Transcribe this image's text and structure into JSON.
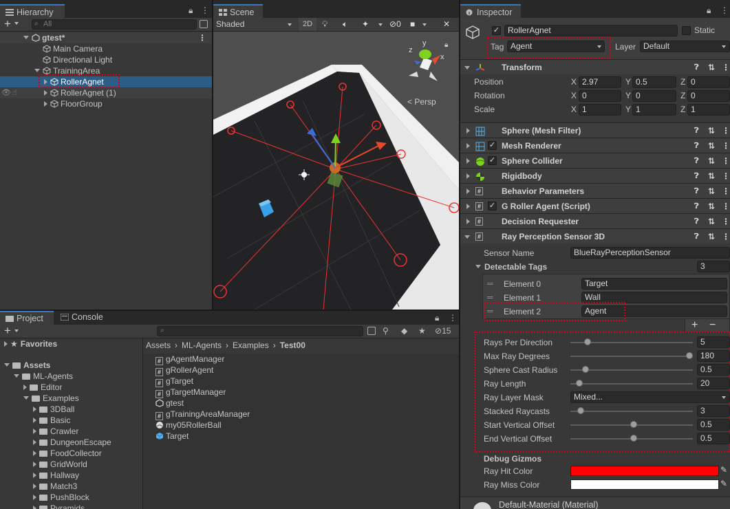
{
  "colors": {
    "selection": "#2c5d87",
    "accent": "#3a79bb",
    "highlight_box": "#d0021b",
    "ray_hit": "#ff0000",
    "ray_miss": "#ffffff"
  },
  "hierarchy": {
    "tab": "Hierarchy",
    "search_placeholder": "All",
    "scene": "gtest*",
    "items": [
      {
        "label": "Main Camera",
        "icon": "gameobject-icon"
      },
      {
        "label": "Directional Light",
        "icon": "gameobject-icon"
      },
      {
        "label": "TrainingArea",
        "icon": "gameobject-icon"
      },
      {
        "label": "RollerAgnet",
        "icon": "prefab-icon"
      },
      {
        "label": "RollerAgnet (1)",
        "icon": "prefab-icon"
      },
      {
        "label": "FloorGroup",
        "icon": "prefab-icon"
      }
    ]
  },
  "scene": {
    "tab": "Scene",
    "shading": "Shaded",
    "mode2d": "2D",
    "hidden_count": "0",
    "persp": "< Persp",
    "gizmo_axes": {
      "y": "y",
      "x": "x",
      "z": "z"
    }
  },
  "project": {
    "tabs": [
      "Project",
      "Console"
    ],
    "hidden_count": "15",
    "breadcrumb": [
      "Assets",
      "ML-Agents",
      "Examples",
      "Test00"
    ],
    "favorites": "Favorites",
    "tree": [
      {
        "label": "Assets",
        "bold": true
      },
      {
        "label": "ML-Agents"
      },
      {
        "label": "Editor"
      },
      {
        "label": "Examples"
      },
      {
        "label": "3DBall"
      },
      {
        "label": "Basic"
      },
      {
        "label": "Crawler"
      },
      {
        "label": "DungeonEscape"
      },
      {
        "label": "FoodCollector"
      },
      {
        "label": "GridWorld"
      },
      {
        "label": "Hallway"
      },
      {
        "label": "Match3"
      },
      {
        "label": "PushBlock"
      },
      {
        "label": "Pyramids"
      }
    ],
    "files": [
      {
        "label": "gAgentManager",
        "icon": "script-icon"
      },
      {
        "label": "gRollerAgent",
        "icon": "script-icon"
      },
      {
        "label": "gTarget",
        "icon": "script-icon"
      },
      {
        "label": "gTargetManager",
        "icon": "script-icon"
      },
      {
        "label": "gtest",
        "icon": "unity-scene-icon"
      },
      {
        "label": "gTrainingAreaManager",
        "icon": "script-icon"
      },
      {
        "label": "my05RollerBall",
        "icon": "material-ball-icon"
      },
      {
        "label": "Target",
        "icon": "prefab-icon"
      }
    ]
  },
  "inspector": {
    "tab": "Inspector",
    "object_name": "RollerAgnet",
    "static_label": "Static",
    "tag_label": "Tag",
    "tag_value": "Agent",
    "layer_label": "Layer",
    "layer_value": "Default",
    "transform": {
      "title": "Transform",
      "rows": [
        {
          "label": "Position",
          "x": "2.97",
          "y": "0.5",
          "z": "0"
        },
        {
          "label": "Rotation",
          "x": "0",
          "y": "0",
          "z": "0"
        },
        {
          "label": "Scale",
          "x": "1",
          "y": "1",
          "z": "1"
        }
      ]
    },
    "components": [
      {
        "title": "Sphere (Mesh Filter)",
        "checkbox": false,
        "icon": "mesh-filter-icon"
      },
      {
        "title": "Mesh Renderer",
        "checkbox": true,
        "icon": "mesh-renderer-icon"
      },
      {
        "title": "Sphere Collider",
        "checkbox": true,
        "icon": "sphere-collider-icon"
      },
      {
        "title": "Rigidbody",
        "checkbox": false,
        "icon": "rigidbody-icon"
      },
      {
        "title": "Behavior Parameters",
        "checkbox": false,
        "icon": "script-icon"
      },
      {
        "title": "G Roller Agent (Script)",
        "checkbox": true,
        "icon": "script-icon"
      },
      {
        "title": "Decision Requester",
        "checkbox": false,
        "icon": "script-icon"
      },
      {
        "title": "Ray Perception Sensor 3D",
        "checkbox": false,
        "icon": "script-icon"
      }
    ],
    "ray_sensor": {
      "sensor_name_label": "Sensor Name",
      "sensor_name": "BlueRayPerceptionSensor",
      "detectable_tags_label": "Detectable Tags",
      "detectable_tags_count": "3",
      "elements": [
        {
          "label": "Element 0",
          "value": "Target"
        },
        {
          "label": "Element 1",
          "value": "Wall"
        },
        {
          "label": "Element 2",
          "value": "Agent"
        }
      ],
      "add_label": "+",
      "remove_label": "−",
      "sliders": [
        {
          "label": "Rays Per Direction",
          "value": "5",
          "fraction": 0.12
        },
        {
          "label": "Max Ray Degrees",
          "value": "180",
          "fraction": 1.0
        },
        {
          "label": "Sphere Cast Radius",
          "value": "0.5",
          "fraction": 0.1
        },
        {
          "label": "Ray Length",
          "value": "20",
          "fraction": 0.05
        }
      ],
      "layer_mask_label": "Ray Layer Mask",
      "layer_mask_value": "Mixed...",
      "sliders2": [
        {
          "label": "Stacked Raycasts",
          "value": "3",
          "fraction": 0.06
        },
        {
          "label": "Start Vertical Offset",
          "value": "0.5",
          "fraction": 0.52
        },
        {
          "label": "End Vertical Offset",
          "value": "0.5",
          "fraction": 0.52
        }
      ],
      "debug_gizmos": "Debug Gizmos",
      "hit_color_label": "Ray Hit Color",
      "miss_color_label": "Ray Miss Color"
    },
    "material": "Default-Material (Material)"
  }
}
